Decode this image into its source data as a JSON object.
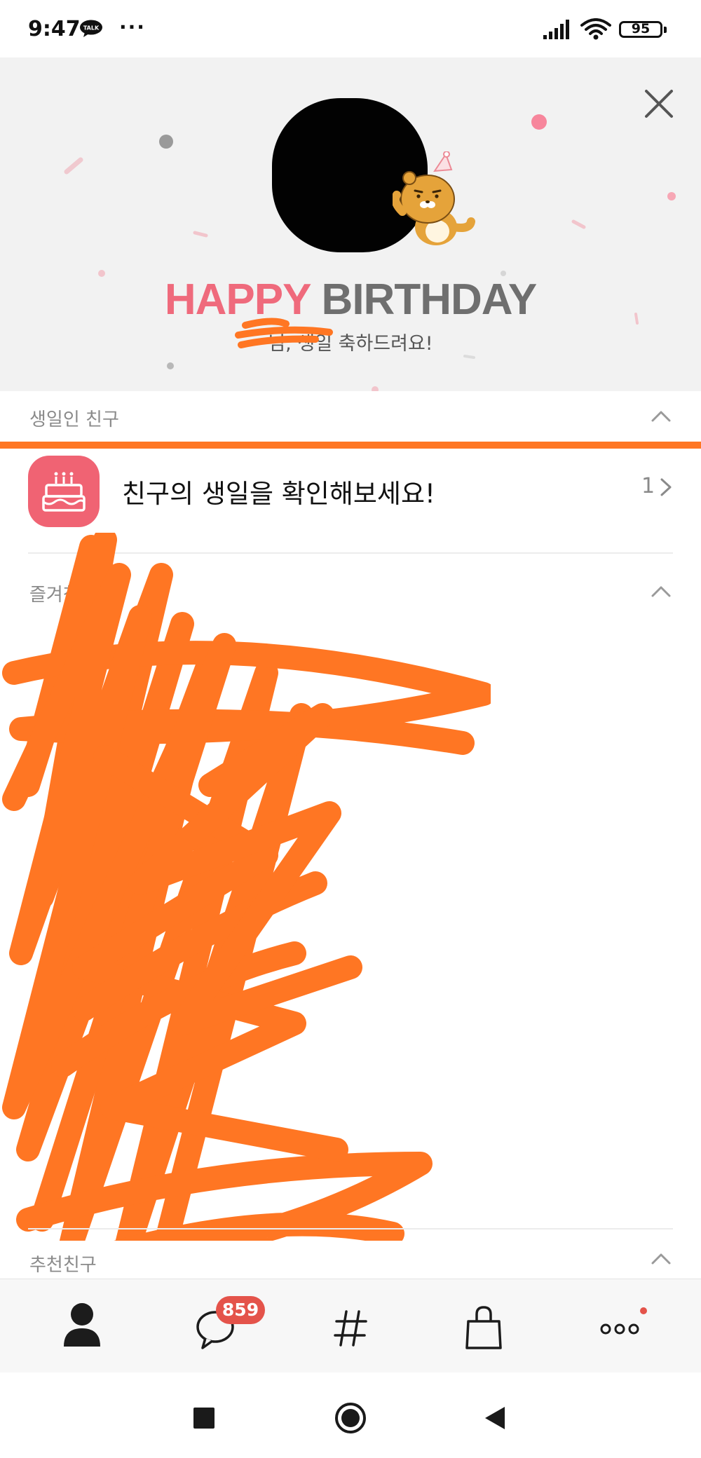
{
  "status_bar": {
    "time": "9:47",
    "talk_icon_label": "TALK",
    "overflow": "···",
    "battery": "95"
  },
  "banner": {
    "title_happy": "HAPPY",
    "title_birthday": "BIRTHDAY",
    "subtitle": "님, 생일 축하드려요!",
    "colors": {
      "happy": "#ef6a7c",
      "birthday": "#6f6f6f",
      "background": "#f2f2f2"
    }
  },
  "birthday_section": {
    "label": "생일인 친구",
    "row_text": "친구의 생일을 확인해보세요!",
    "count": "1",
    "icon": "cake-icon"
  },
  "favorites_section": {
    "label": "즐겨찾기"
  },
  "recommended_section": {
    "label": "추천친구"
  },
  "bottom_nav": {
    "items": [
      {
        "name": "friends",
        "icon": "person-icon"
      },
      {
        "name": "chats",
        "icon": "chat-bubble-icon",
        "badge": "859"
      },
      {
        "name": "view",
        "icon": "hashtag-icon"
      },
      {
        "name": "shopping",
        "icon": "shopping-bag-icon"
      },
      {
        "name": "more",
        "icon": "more-dots-icon"
      }
    ],
    "accent": "#e4534a"
  },
  "system_nav": [
    "recents-square",
    "home-circle",
    "back-triangle"
  ],
  "redaction_color": "#ff7623"
}
